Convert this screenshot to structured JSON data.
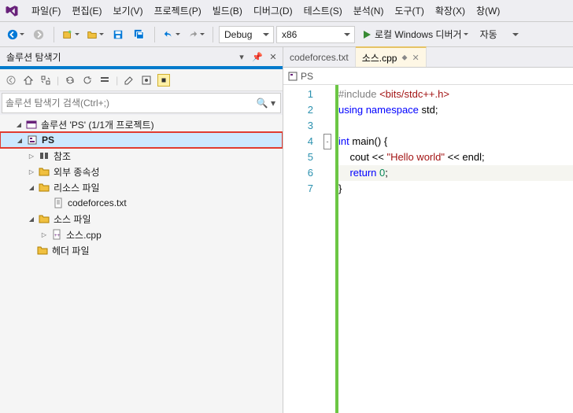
{
  "menu": {
    "items": [
      "파일(F)",
      "편집(E)",
      "보기(V)",
      "프로젝트(P)",
      "빌드(B)",
      "디버그(D)",
      "테스트(S)",
      "분석(N)",
      "도구(T)",
      "확장(X)",
      "창(W)"
    ]
  },
  "toolbar": {
    "config": "Debug",
    "platform": "x86",
    "run_label": "로컬 Windows 디버거",
    "run_mode": "자동"
  },
  "panel": {
    "title": "솔루션 탐색기",
    "search_placeholder": "솔루션 탐색기 검색(Ctrl+;)"
  },
  "tree": {
    "solution": "솔루션 'PS' (1/1개 프로젝트)",
    "project": "PS",
    "refs": "참조",
    "external": "외부 종속성",
    "resources": "리소스 파일",
    "resources_file": "codeforces.txt",
    "sources": "소스 파일",
    "sources_file": "소스.cpp",
    "headers": "헤더 파일"
  },
  "tabs": {
    "inactive": "codeforces.txt",
    "active": "소스.cpp"
  },
  "navbar": {
    "scope": "PS"
  },
  "code": {
    "lines": [
      {
        "n": 1,
        "html": "<span class='preproc'>#include</span> <span class='include-file'>&lt;bits/stdc++.h&gt;</span>"
      },
      {
        "n": 2,
        "html": "<span class='kw-blue'>using</span> <span class='kw-blue'>namespace</span> <span class='ident'>std</span>;"
      },
      {
        "n": 3,
        "html": ""
      },
      {
        "n": 4,
        "html": "<span class='kw-blue'>int</span> <span class='ident'>main</span>() {"
      },
      {
        "n": 5,
        "html": "    <span class='ident'>cout</span> &lt;&lt; <span class='str-red'>\"Hello world\"</span> &lt;&lt; <span class='ident'>endl</span>;"
      },
      {
        "n": 6,
        "html": "    <span class='kw-blue'>return</span> <span class='num'>0</span>;"
      },
      {
        "n": 7,
        "html": "}"
      }
    ]
  }
}
